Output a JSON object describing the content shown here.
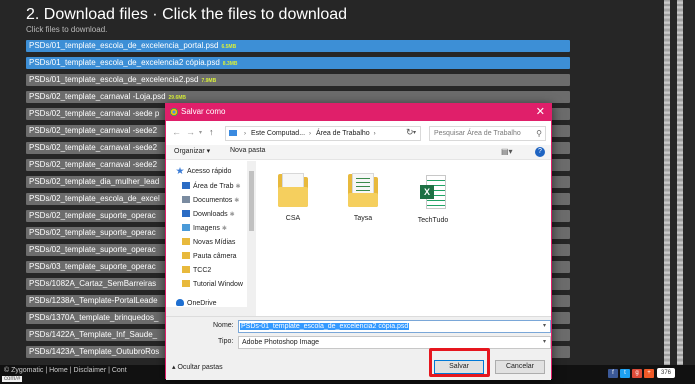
{
  "page": {
    "title": "2. Download files · Click the files to download",
    "subtitle": "Click files to download.",
    "files": [
      {
        "name": "PSDs/01_template_escola_de_excelencia_portal.psd",
        "size": "6.5MB",
        "selected": true
      },
      {
        "name": "PSDs/01_template_escola_de_excelencia2 cópia.psd",
        "size": "8.3MB",
        "selected": true
      },
      {
        "name": "PSDs/01_template_escola_de_excelencia2.psd",
        "size": "7.9MB",
        "selected": false
      },
      {
        "name": "PSDs/02_template_carnaval -Loja.psd",
        "size": "29.6MB",
        "selected": false
      },
      {
        "name": "PSDs/02_template_carnaval -sede p",
        "size": "",
        "selected": false
      },
      {
        "name": "PSDs/02_template_carnaval -sede2",
        "size": "",
        "selected": false
      },
      {
        "name": "PSDs/02_template_carnaval -sede2",
        "size": "",
        "selected": false
      },
      {
        "name": "PSDs/02_template_carnaval -sede2",
        "size": "",
        "selected": false
      },
      {
        "name": "PSDs/02_template_dia_mulher_lead",
        "size": "",
        "selected": false
      },
      {
        "name": "PSDs/02_template_escola_de_excel",
        "size": "",
        "selected": false
      },
      {
        "name": "PSDs/02_template_suporte_operac",
        "size": "",
        "selected": false
      },
      {
        "name": "PSDs/02_template_suporte_operac",
        "size": "",
        "selected": false
      },
      {
        "name": "PSDs/02_template_suporte_operac",
        "size": "",
        "selected": false
      },
      {
        "name": "PSDs/03_template_suporte_operac",
        "size": "",
        "selected": false
      },
      {
        "name": "PSDs/1082A_Cartaz_SemBarreiras",
        "size": "",
        "selected": false
      },
      {
        "name": "PSDs/1238A_Template-PortalLeade",
        "size": "",
        "selected": false
      },
      {
        "name": "PSDs/1370A_template_brinquedos_",
        "size": "",
        "selected": false
      },
      {
        "name": "PSDs/1422A_Template_Inf_Saude_",
        "size": "",
        "selected": false
      },
      {
        "name": "PSDs/1423A_Template_OutubroRos",
        "size": "",
        "selected": false
      }
    ],
    "footer_text": "© Zygomatic | Home | Disclaimer | Cont",
    "url_text": "com/#",
    "share_count": "376"
  },
  "dialog": {
    "title": "Salvar como",
    "close_glyph": "✕",
    "breadcrumb": [
      "Este Computad...",
      "Área de Trabalho"
    ],
    "search_placeholder": "Pesquisar Área de Trabalho",
    "toolbar": {
      "organize": "Organizar ▾",
      "new_folder": "Nova pasta"
    },
    "nav_items": [
      {
        "label": "Acesso rápido",
        "icon": "star-icon",
        "color": "#3a7bd5",
        "pinned": false
      },
      {
        "label": "Área de Trab",
        "icon": "desktop-icon",
        "color": "#2b6cc4",
        "pinned": true
      },
      {
        "label": "Documentos",
        "icon": "documents-icon",
        "color": "#7a8ba0",
        "pinned": true
      },
      {
        "label": "Downloads",
        "icon": "download-icon",
        "color": "#2b6cc4",
        "pinned": true
      },
      {
        "label": "Imagens",
        "icon": "pictures-icon",
        "color": "#4a9ad8",
        "pinned": true
      },
      {
        "label": "Novas Mídias",
        "icon": "folder-icon",
        "color": "#e8b93c",
        "pinned": false
      },
      {
        "label": "Pauta câmera",
        "icon": "folder-icon",
        "color": "#e8b93c",
        "pinned": false
      },
      {
        "label": "TCC2",
        "icon": "folder-icon",
        "color": "#e8b93c",
        "pinned": false
      },
      {
        "label": "Tutorial Window",
        "icon": "folder-icon",
        "color": "#e8b93c",
        "pinned": false
      },
      {
        "label": "OneDrive",
        "icon": "onedrive-icon",
        "color": "#1e6fd1",
        "pinned": false
      }
    ],
    "items": [
      {
        "label": "CSA",
        "kind": "folder"
      },
      {
        "label": "Taysa",
        "kind": "folder-xl"
      },
      {
        "label": "TechTudo",
        "kind": "excel"
      }
    ],
    "name_label": "Nome:",
    "name_value": "PSDs-01_template_escola_de_excelencia2 cópia.psd",
    "type_label": "Tipo:",
    "type_value": "Adobe Photoshop Image",
    "hide_folders": "Ocultar pastas",
    "save_label": "Salvar",
    "cancel_label": "Cancelar"
  },
  "colors": {
    "accent": "#e01f6a",
    "highlight": "#e6161e",
    "selected_row": "#3d8fd6"
  }
}
